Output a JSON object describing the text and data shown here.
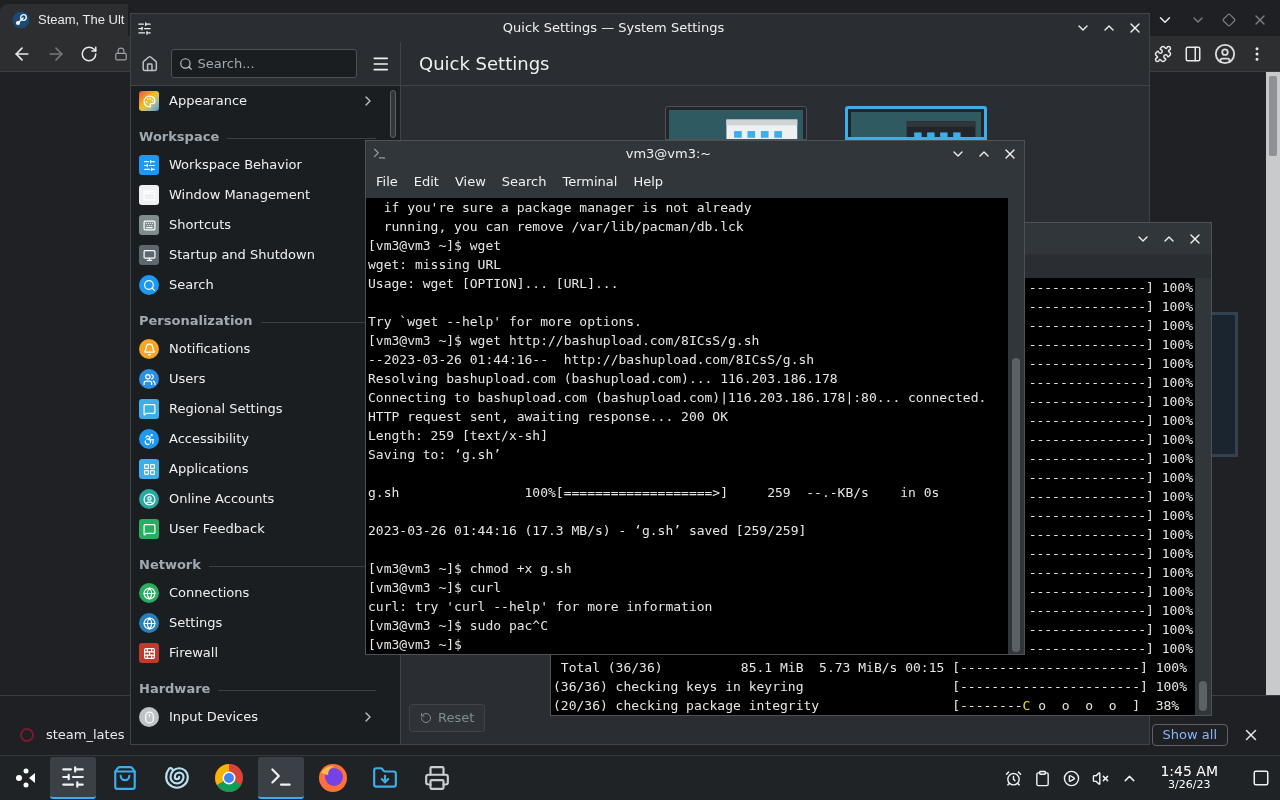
{
  "browser": {
    "tab_title": "Steam, The Ult",
    "download": {
      "file": "steam_lates",
      "show_all": "Show all"
    }
  },
  "settings_window": {
    "title": "Quick Settings — System Settings",
    "search_placeholder": "Search...",
    "page_title": "Quick Settings",
    "top_items": [
      {
        "label": "Appearance",
        "chevron": true
      }
    ],
    "sections": [
      {
        "heading": "Workspace",
        "items": [
          {
            "label": "Workspace Behavior"
          },
          {
            "label": "Window Management"
          },
          {
            "label": "Shortcuts"
          },
          {
            "label": "Startup and Shutdown"
          },
          {
            "label": "Search"
          }
        ]
      },
      {
        "heading": "Personalization",
        "items": [
          {
            "label": "Notifications"
          },
          {
            "label": "Users"
          },
          {
            "label": "Regional Settings"
          },
          {
            "label": "Accessibility"
          },
          {
            "label": "Applications"
          },
          {
            "label": "Online Accounts"
          },
          {
            "label": "User Feedback"
          }
        ]
      },
      {
        "heading": "Network",
        "items": [
          {
            "label": "Connections"
          },
          {
            "label": "Settings"
          },
          {
            "label": "Firewall"
          }
        ]
      },
      {
        "heading": "Hardware",
        "items": [
          {
            "label": "Input Devices",
            "chevron": true
          }
        ]
      }
    ],
    "themes": [
      {
        "kind": "picture",
        "selected": false
      },
      {
        "kind": "picture",
        "selected": true
      }
    ],
    "reset_button": "Reset"
  },
  "back_terminal": {
    "partial_rows": [
      "---------------] 100%",
      "---------------] 100%",
      "---------------] 100%",
      "---------------] 100%",
      "---------------] 100%",
      "---------------] 100%",
      "---------------] 100%",
      "---------------] 100%",
      "---------------] 100%",
      "---------------] 100%",
      "---------------] 100%",
      "---------------] 100%",
      "---------------] 100%",
      "---------------] 100%",
      "---------------] 100%",
      "---------------] 100%",
      "---------------] 100%",
      "---------------] 100%",
      "---------------] 100%",
      "---------------] 100%"
    ],
    "lines": [
      {
        "parts": [
          {
            "text": " Total (36/36)          85.1 MiB  5.73 MiB/s 00:15 [-----------------------] 100%",
            "highlight": false
          }
        ]
      },
      {
        "parts": [
          {
            "text": "(36/36) checking keys in keyring                   [-----------------------] 100%",
            "highlight": false
          }
        ]
      },
      {
        "parts": [
          {
            "text": "(20/36) checking package integrity                 [--------",
            "highlight": false
          },
          {
            "text": "C",
            "highlight": true
          },
          {
            "text": " o  o  o  o  ]  38%",
            "highlight": false
          }
        ]
      }
    ]
  },
  "terminal": {
    "title": "vm3@vm3:~",
    "menu": [
      "File",
      "Edit",
      "View",
      "Search",
      "Terminal",
      "Help"
    ],
    "blocks": [
      [
        "  if you're sure a package manager is not already",
        "  running, you can remove /var/lib/pacman/db.lck",
        "[vm3@vm3 ~]$ wget",
        "wget: missing URL",
        "Usage: wget [OPTION]... [URL]..."
      ],
      [
        "Try `wget --help' for more options.",
        "[vm3@vm3 ~]$ wget http://bashupload.com/8ICsS/g.sh",
        "--2023-03-26 01:44:16--  http://bashupload.com/8ICsS/g.sh",
        "Resolving bashupload.com (bashupload.com)... 116.203.186.178",
        "Connecting to bashupload.com (bashupload.com)|116.203.186.178|:80... connected.",
        "HTTP request sent, awaiting response... 200 OK",
        "Length: 259 [text/x-sh]",
        "Saving to: ‘g.sh’"
      ],
      [
        "g.sh                100%[===================>]     259  --.-KB/s    in 0s"
      ],
      [
        "2023-03-26 01:44:16 (17.3 MB/s) - ‘g.sh’ saved [259/259]"
      ],
      [
        "[vm3@vm3 ~]$ chmod +x g.sh",
        "[vm3@vm3 ~]$ curl",
        "curl: try 'curl --help' for more information",
        "[vm3@vm3 ~]$ sudo pac^C",
        "[vm3@vm3 ~]$"
      ]
    ]
  },
  "taskbar": {
    "apps": [
      {
        "selected": true
      },
      {
        "selected": false
      },
      {
        "selected": false
      },
      {
        "selected": false
      },
      {
        "selected": true
      },
      {
        "selected": false
      },
      {
        "selected": false
      },
      {
        "selected": false
      }
    ],
    "clock": {
      "time": "1:45 AM",
      "date": "3/26/23"
    }
  }
}
